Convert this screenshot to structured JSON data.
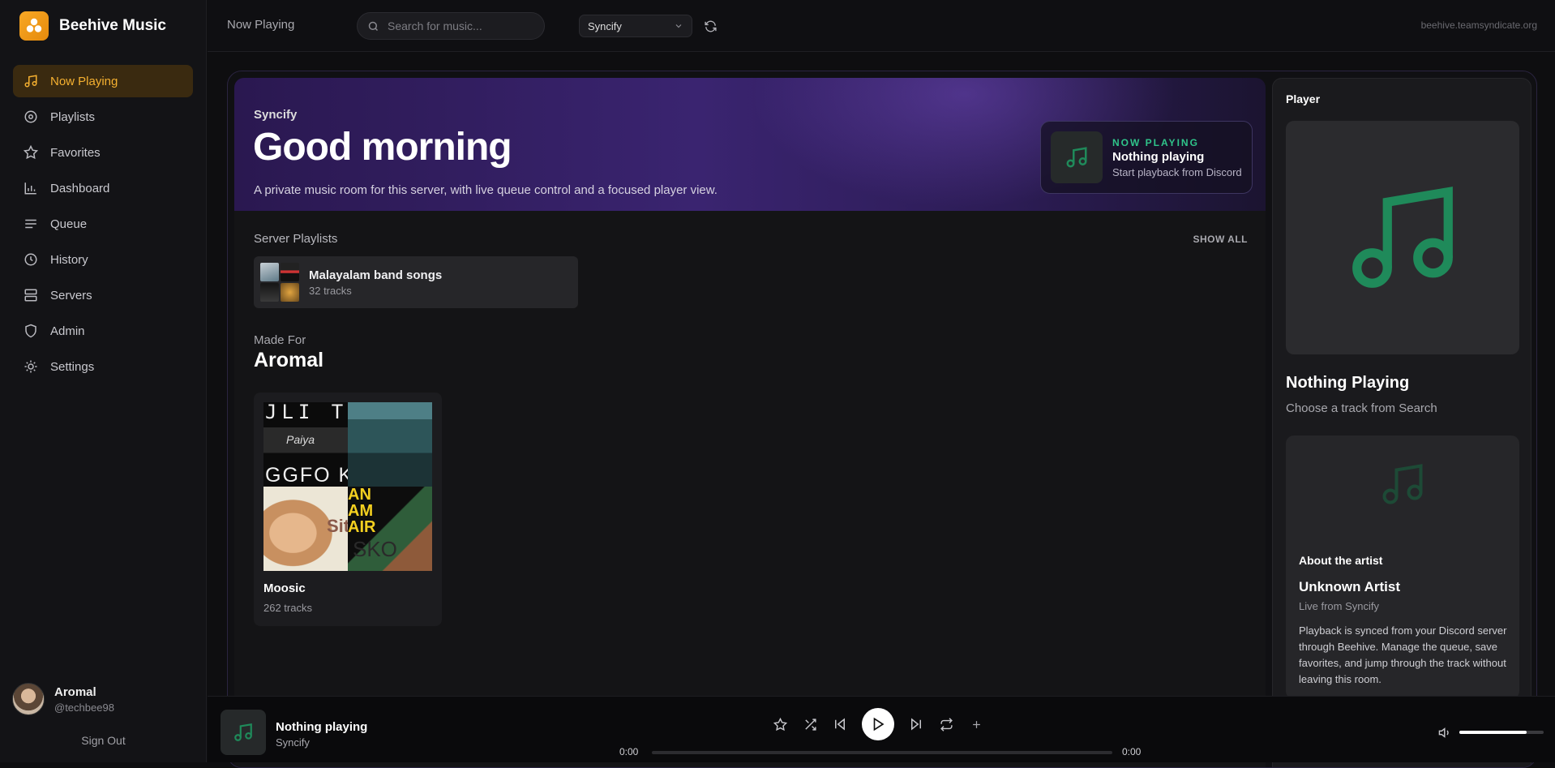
{
  "brand": {
    "name": "Beehive Music"
  },
  "sidebar": {
    "items": [
      {
        "label": "Now Playing",
        "icon": "music-note-icon",
        "active": true
      },
      {
        "label": "Playlists",
        "icon": "disc-icon"
      },
      {
        "label": "Favorites",
        "icon": "star-icon"
      },
      {
        "label": "Dashboard",
        "icon": "bar-chart-icon"
      },
      {
        "label": "Queue",
        "icon": "list-icon"
      },
      {
        "label": "History",
        "icon": "clock-icon"
      },
      {
        "label": "Servers",
        "icon": "server-icon"
      },
      {
        "label": "Admin",
        "icon": "shield-icon"
      },
      {
        "label": "Settings",
        "icon": "sun-icon"
      }
    ]
  },
  "user": {
    "name": "Aromal",
    "handle": "@techbee98",
    "sign_out": "Sign Out"
  },
  "topbar": {
    "title": "Now Playing",
    "search_placeholder": "Search for music...",
    "server_select": "Syncify",
    "domain": "beehive.teamsyndicate.org"
  },
  "hero": {
    "source": "Syncify",
    "greeting": "Good morning",
    "subtitle": "A private music room for this server, with live queue control and a focused player view.",
    "now_playing": {
      "label": "NOW PLAYING",
      "title": "Nothing playing",
      "desc": "Start playback from Discord"
    }
  },
  "server_playlists": {
    "title": "Server Playlists",
    "show_all": "SHOW ALL",
    "items": [
      {
        "title": "Malayalam band songs",
        "count": "32 tracks"
      }
    ]
  },
  "made_for": {
    "label": "Made For",
    "name": "Aromal",
    "albums": [
      {
        "title": "Moosic",
        "count": "262 tracks",
        "art_text": [
          "JLI TH",
          "Paiya",
          "GGFO KA",
          "AN AM AIR",
          "Siti",
          "SKO"
        ]
      }
    ]
  },
  "player": {
    "heading": "Player",
    "title": "Nothing Playing",
    "subtitle": "Choose a track from Search",
    "about": {
      "heading": "About the artist",
      "name": "Unknown Artist",
      "live": "Live from Syncify",
      "desc": "Playback is synced from your Discord server through Beehive. Manage the queue, save favorites, and jump through the track without leaving this room."
    }
  },
  "bottom": {
    "title": "Nothing playing",
    "sub": "Syncify",
    "time_current": "0:00",
    "time_total": "0:00",
    "progress": 0,
    "volume": 0.8
  },
  "colors": {
    "accent": "#f5b030",
    "green": "#2fc48a",
    "brand": "#f8a825"
  }
}
